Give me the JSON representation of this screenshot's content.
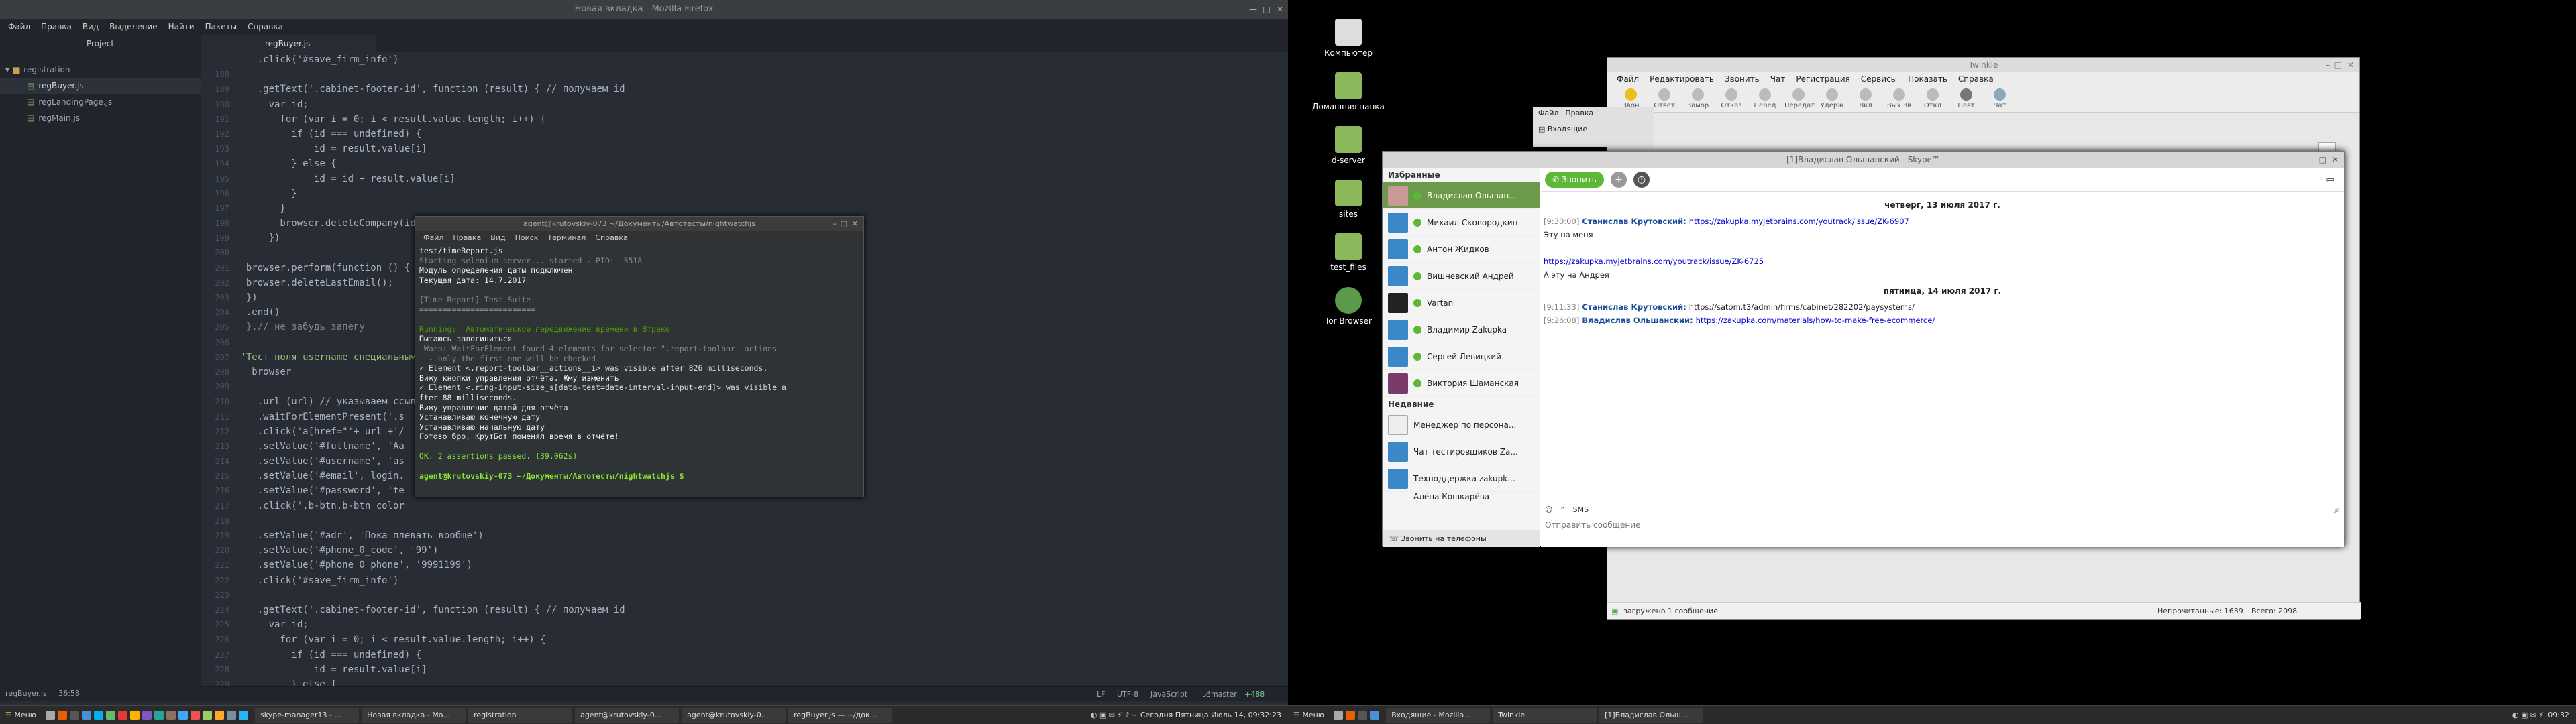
{
  "left_monitor": {
    "window_title": "Новая вкладка - Mozilla Firefox",
    "menu": [
      "Файл",
      "Правка",
      "Вид",
      "Выделение",
      "Найти",
      "Пакеты",
      "Справка"
    ],
    "tree": {
      "header": "Project",
      "folder": "registration",
      "files": [
        "regBuyer.js",
        "regLandingPage.js",
        "regMain.js"
      ]
    },
    "tab": "regBuyer.js",
    "line_numbers": [
      "",
      "188",
      "189",
      "190",
      "191",
      "192",
      "193",
      "194",
      "195",
      "196",
      "197",
      "198",
      "199",
      "200",
      "201",
      "202",
      "203",
      "204",
      "205",
      "206",
      "207",
      "208",
      "209",
      "210",
      "211",
      "212",
      "213",
      "214",
      "215",
      "216",
      "217",
      "218",
      "219",
      "220",
      "221",
      "222",
      "223",
      "224",
      "225",
      "226",
      "227",
      "228",
      "229"
    ],
    "code_lines": [
      "    .click('#save_firm_info')",
      "",
      "    .getText('.cabinet-footer-id', function (result) { // получаем id",
      "      var id;",
      "        for (var i = 0; i < result.value.length; i++) {",
      "          if (id === undefined) {",
      "              id = result.value[i]",
      "          } else {",
      "              id = id + result.value[i]",
      "          }",
      "        }",
      "        browser.deleteCompany(id)",
      "      })",
      "",
      "  browser.perform(function () {",
      "  browser.deleteLastEmail();",
      "  })",
      "  .end()",
      "  },// не забудь запегу",
      "",
      " 'Тест поля username специальными символами': function(browser) {",
      "   browser",
      "",
      "    .url (url) // указываем ссылку                                         ожидание 5000",
      "    .waitForElementPresent('.s",
      "    .click('a[href=\"'+ url +'/",
      "    .setValue('#fullname', 'Aa",
      "    .setValue('#username', 'as",
      "    .setValue('#email', login.",
      "    .setValue('#password', 'te",
      "    .click('.b-btn.b-btn_color",
      "",
      "    .setValue('#adr', 'Пока плевать вообще')",
      "    .setValue('#phone_0_code', '99')",
      "    .setValue('#phone_0_phone', '9991199')",
      "    .click('#save_firm_info')",
      "",
      "    .getText('.cabinet-footer-id', function (result) { // получаем id",
      "      var id;",
      "        for (var i = 0; i < result.value.length; i++) {",
      "          if (id === undefined) {",
      "              id = result.value[i]",
      "          } else {"
    ],
    "status": {
      "file": "regBuyer.js",
      "pos": "36:58",
      "eol": "LF",
      "enc": "UTF-8",
      "lang": "JavaScript",
      "branch": "master",
      "diff": "+488"
    },
    "terminal": {
      "title": "agent@krutovskiy-073 ~/Документы/Автотесты/nightwatchjs",
      "menu": [
        "Файл",
        "Правка",
        "Вид",
        "Поиск",
        "Терминал",
        "Справка"
      ],
      "lines": [
        "test/timeReport.js",
        "Starting selenium server... started - PID:  3518",
        "Модуль определения даты подключен",
        "Текущая дата: 14.7.2017",
        "",
        "[Time Report] Test Suite",
        "=========================",
        "",
        "Running:  Автоматическое передвижение времени в Втреке",
        "Пытаюсь залогиниться",
        " Warn: WaitForElement found 4 elements for selector \".report-toolbar__actions__",
        "  - only the first one will be checked.",
        "✓ Element <.report-toolbar__actions__i> was visible after 826 milliseconds.",
        "Вижу кнопки управления отчёта. Жму изменить",
        "✓ Element <.ring-input-size_s[data-test=date-interval-input-end]> was visible a",
        "fter 88 milliseconds.",
        "Вижу управление датой для отчёта",
        "Устанавливаю конечную дату",
        "Устанавливаю начальную дату",
        "Готово бро, КрутБот поменял время в отчёте!",
        "",
        "OK. 2 assertions passed. (39.062s)",
        "",
        "agent@krutovskiy-073 ~/Документы/Автотесты/nightwatchjs $"
      ]
    },
    "taskbar": {
      "menu": "Меню",
      "windows": [
        "skype-manager13 - ...",
        "Новая вкладка - Mo...",
        "registration",
        "agent@krutovskiy-0...",
        "agent@krutovskiy-0...",
        "regBuyer.js — ~/док..."
      ],
      "clock": "Сегодня Пятница Июль 14, 09:32:23"
    }
  },
  "right_monitor": {
    "desktop_icons": [
      "Компьютер",
      "Домашняя папка",
      "d-server",
      "sites",
      "test_files",
      "Tor Browser"
    ],
    "twinkle": {
      "title": "Twinkle",
      "menu": [
        "Файл",
        "Редактировать",
        "Звонить",
        "Чат",
        "Регистрация",
        "Сервисы",
        "Показать",
        "Справка"
      ],
      "toolbar": [
        "Звон",
        "Ответ",
        "Замор",
        "Отказ",
        "Перед",
        "Передат",
        "Удерж",
        "Вкл",
        "Вых.Зв",
        "Откл",
        "Повт",
        "Чат"
      ],
      "status_left": "загружено 1 сообщение",
      "status_mid": "Непрочитанные: 1639",
      "status_right": "Всего: 2098"
    },
    "back_window": {
      "menu": [
        "Файл",
        "Правка"
      ],
      "tab": "Входящие"
    },
    "skype": {
      "title": "[1]Владислав Ольшанский - Skype™",
      "favorites_header": "Избранные",
      "contacts": [
        "Владислав Ольшан...",
        "Михаил Сковородкин",
        "Антон Жидков",
        "Вишневский Андрей",
        "Vartan",
        "Владимир Zakupka",
        "Сергей Левицкий",
        "Виктория Шаманская"
      ],
      "recent_header": "Недавние",
      "recent": [
        "Менеджер по персона...",
        "Чат тестировщиков Za...",
        "Техподдержка zakupk...",
        "Алёна Кошкарёва"
      ],
      "bottom": "Звонить на телефоны",
      "call_button": "Звонить",
      "messages": [
        {
          "type": "date",
          "text": "четверг, 13 июля 2017 г."
        },
        {
          "type": "msg",
          "time": "[9:30:00]",
          "author": "Станислав Крутовский:",
          "link": "https://zakupka.myjetbrains.com/youtrack/issue/ZK-6907",
          "text": ""
        },
        {
          "type": "text",
          "text": "Эту на меня"
        },
        {
          "type": "blank",
          "text": ""
        },
        {
          "type": "link",
          "text": "https://zakupka.myjetbrains.com/youtrack/issue/ZK-6725"
        },
        {
          "type": "text",
          "text": "А эту на Андрея"
        },
        {
          "type": "date",
          "text": "пятница, 14 июля 2017 г."
        },
        {
          "type": "msg",
          "time": "[9:11:33]",
          "author": "Станислав Крутовский:",
          "link": "",
          "text": "https://satom.t3/admin/firms/cabinet/282202/paysystems/"
        },
        {
          "type": "msg",
          "time": "[9:26:08]",
          "author": "Владислав Ольшанский:",
          "link": "https://zakupka.com/materials/how-to-make-free-ecommerce/",
          "text": ""
        }
      ],
      "sms_label": "SMS",
      "input_placeholder": "Отправить сообщение"
    },
    "taskbar": {
      "menu": "Меню",
      "windows": [
        "Входящие - Mozilla ...",
        "Twinkle",
        "[1]Владислав Ольш..."
      ],
      "clock": "09:32"
    }
  }
}
